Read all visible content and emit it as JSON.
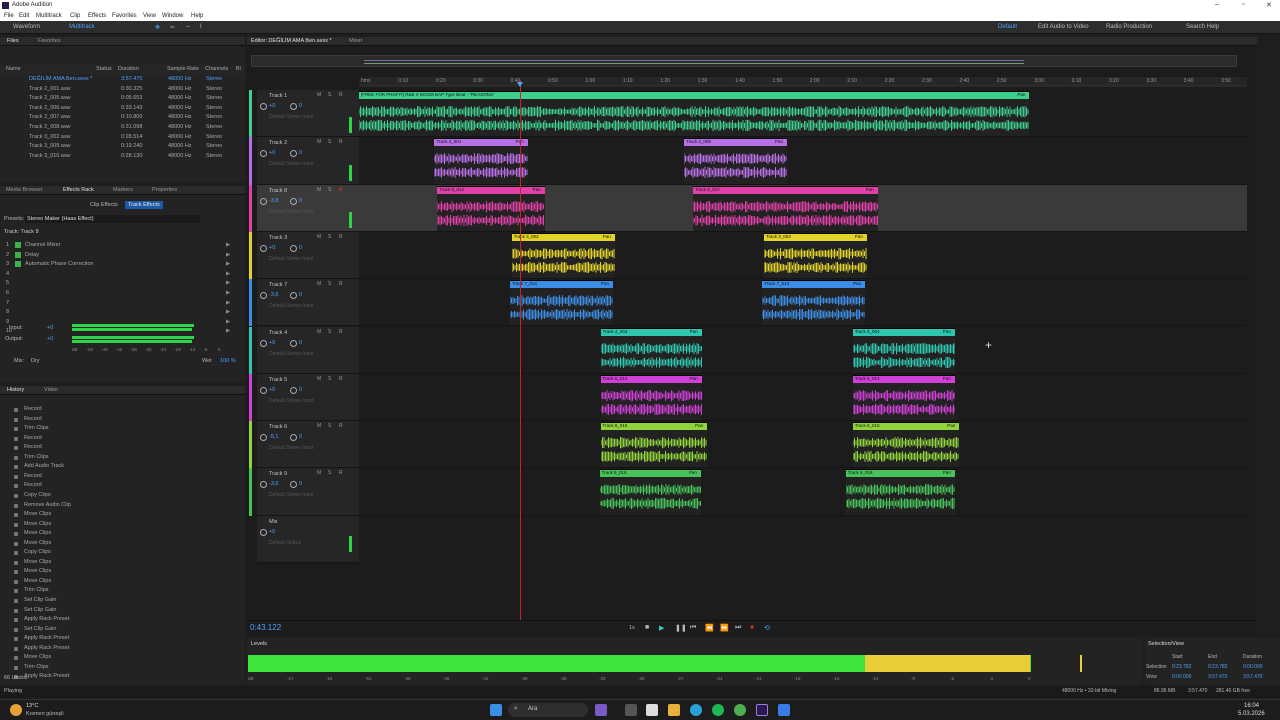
{
  "window": {
    "title": "Adobe Audition"
  },
  "menu": [
    "File",
    "Edit",
    "Multitrack",
    "Clip",
    "Effects",
    "Favorites",
    "View",
    "Window",
    "Help"
  ],
  "toolbar": {
    "waveform": "Waveform",
    "multitrack": "Multitrack",
    "workspaces": [
      "Default",
      "Edit Audio to Video",
      "Radio Production"
    ],
    "search": "Search Help"
  },
  "files_panel": {
    "tabs": [
      "Files",
      "Favorites"
    ],
    "columns": [
      "Name",
      "Status",
      "Duration",
      "Sample Rate",
      "Channels",
      "Bi"
    ],
    "rows": [
      {
        "name": "DEĞİLİM AMA Ben.sesx *",
        "duration": "3:57.470",
        "rate": "48000 Hz",
        "ch": "Stereo"
      },
      {
        "name": "Track 2_001.wav",
        "duration": "0:30.325",
        "rate": "48000 Hz",
        "ch": "Stereo"
      },
      {
        "name": "Track 2_005.wav",
        "duration": "0:05.653",
        "rate": "48000 Hz",
        "ch": "Stereo"
      },
      {
        "name": "Track 2_006.wav",
        "duration": "0:33.143",
        "rate": "48000 Hz",
        "ch": "Stereo"
      },
      {
        "name": "Track 2_007.wav",
        "duration": "0:10.800",
        "rate": "48000 Hz",
        "ch": "Stereo"
      },
      {
        "name": "Track 2_008.wav",
        "duration": "0:31.098",
        "rate": "48000 Hz",
        "ch": "Stereo"
      },
      {
        "name": "Track 3_002.wav",
        "duration": "0:28.514",
        "rate": "48000 Hz",
        "ch": "Stereo"
      },
      {
        "name": "Track 3_009.wav",
        "duration": "0:19.240",
        "rate": "48000 Hz",
        "ch": "Stereo"
      },
      {
        "name": "Track 3_010.wav",
        "duration": "0:28.130",
        "rate": "48000 Hz",
        "ch": "Stereo"
      }
    ]
  },
  "effects_panel": {
    "tabs": [
      "Media Browser",
      "Effects Rack",
      "Markers",
      "Properties"
    ],
    "subtabs": [
      "Clip Effects",
      "Track Effects"
    ],
    "presets_label": "Presets:",
    "preset": "Stereo Maker (Haas Effect)",
    "track_label": "Track: Track 8",
    "effects": [
      {
        "n": "1",
        "name": "Channel Mixer"
      },
      {
        "n": "2",
        "name": "Delay"
      },
      {
        "n": "3",
        "name": "Automatic Phase Correction"
      },
      {
        "n": "4",
        "name": ""
      },
      {
        "n": "5",
        "name": ""
      },
      {
        "n": "6",
        "name": ""
      },
      {
        "n": "7",
        "name": ""
      },
      {
        "n": "8",
        "name": ""
      },
      {
        "n": "9",
        "name": ""
      },
      {
        "n": "10",
        "name": ""
      }
    ],
    "input_label": "Input:",
    "input_val": "+0",
    "output_label": "Output:",
    "output_val": "+0",
    "mix_label": "Mix:",
    "dry": "Dry",
    "wet": "Wet",
    "wet_pct": "100 %",
    "meter_scale": [
      "dB",
      "-54",
      "-48",
      "-42",
      "-36",
      "-30",
      "-24",
      "-18",
      "-12",
      "-6",
      "0"
    ]
  },
  "history_panel": {
    "tabs": [
      "History",
      "Video"
    ],
    "items": [
      "Record",
      "Record",
      "Trim Clips",
      "Record",
      "Record",
      "Trim Clips",
      "Add Audio Track",
      "Record",
      "Record",
      "Copy Clips",
      "Remove Audio Clip",
      "Move Clips",
      "Move Clips",
      "Move Clips",
      "Move Clips",
      "Copy Clips",
      "Move Clips",
      "Move Clips",
      "Move Clips",
      "Trim Clips",
      "Set Clip Gain",
      "Set Clip Gain",
      "Apply Rack Preset",
      "Set Clip Gain",
      "Apply Rack Preset",
      "Apply Rack Preset",
      "Move Clips",
      "Trim Clips",
      "Apply Rack Preset"
    ],
    "undos": "66 Undos"
  },
  "editor": {
    "tab": "Editor: DEĞİLİM AMA Ben.sesx *",
    "mixer_tab": "Mixer",
    "ruler": [
      "hms",
      "0:10",
      "0:20",
      "0:30",
      "0:40",
      "0:50",
      "1:00",
      "1:10",
      "1:20",
      "1:30",
      "1:40",
      "1:50",
      "2:00",
      "2:10",
      "2:20",
      "2:30",
      "2:40",
      "2:50",
      "3:00",
      "3:10",
      "3:20",
      "3:30",
      "3:40",
      "3:50"
    ],
    "time": "0:43.122",
    "transport_speed": "1x",
    "default_input": "Default Stereo Input",
    "default_output": "Default Output"
  },
  "tracks": [
    {
      "name": "Track 1",
      "vol": "+0",
      "pan": "0",
      "color": "#3ecf8e",
      "clips": [
        {
          "name": "[FREE FOR PROFIT] R&B X BOOM BAP Type Beat - \"REASONS\"",
          "pan": "Pan",
          "color": "#3ecf8e",
          "start": 0,
          "end": 0.755
        }
      ]
    },
    {
      "name": "Track 2",
      "vol": "+0",
      "pan": "0",
      "color": "#b86ee6",
      "clips": [
        {
          "name": "Track 2_001",
          "pan": "Pan",
          "color": "#b86ee6",
          "start": 0.085,
          "end": 0.19
        },
        {
          "name": "Track 2_008",
          "pan": "Pan",
          "color": "#b86ee6",
          "start": 0.366,
          "end": 0.482
        }
      ]
    },
    {
      "name": "Track 8",
      "vol": "-3,8",
      "pan": "0",
      "color": "#e040a8",
      "clips": [
        {
          "name": "Track 8_012",
          "pan": "Pan",
          "color": "#e040a8",
          "start": 0.088,
          "end": 0.209
        },
        {
          "name": "Track 8_017",
          "pan": "Pan",
          "color": "#e040a8",
          "start": 0.376,
          "end": 0.584
        }
      ]
    },
    {
      "name": "Track 3",
      "vol": "+0",
      "pan": "0",
      "color": "#e3d22a",
      "clips": [
        {
          "name": "Track 3_002",
          "pan": "Pan",
          "color": "#e3d22a",
          "start": 0.172,
          "end": 0.288
        },
        {
          "name": "Track 3_003",
          "pan": "Pan",
          "color": "#e3d22a",
          "start": 0.456,
          "end": 0.572
        }
      ]
    },
    {
      "name": "Track 7",
      "vol": "-3,6",
      "pan": "0",
      "color": "#3c8de8",
      "clips": [
        {
          "name": "Track 7_013",
          "pan": "Pan",
          "color": "#3c8de8",
          "start": 0.17,
          "end": 0.286
        },
        {
          "name": "Track 7_013",
          "pan": "Pan",
          "color": "#3c8de8",
          "start": 0.454,
          "end": 0.57
        }
      ]
    },
    {
      "name": "Track 4",
      "vol": "+0",
      "pan": "0",
      "color": "#2fc6b0",
      "clips": [
        {
          "name": "Track 4_004",
          "pan": "Pan",
          "color": "#2fc6b0",
          "start": 0.272,
          "end": 0.386
        },
        {
          "name": "Track 4_004",
          "pan": "Pan",
          "color": "#2fc6b0",
          "start": 0.556,
          "end": 0.671
        }
      ]
    },
    {
      "name": "Track 5",
      "vol": "+0",
      "pan": "0",
      "color": "#d040d8",
      "clips": [
        {
          "name": "Track 5_014",
          "pan": "Pan",
          "color": "#d040d8",
          "start": 0.272,
          "end": 0.386
        },
        {
          "name": "Track 5_014",
          "pan": "Pan",
          "color": "#d040d8",
          "start": 0.556,
          "end": 0.671
        }
      ]
    },
    {
      "name": "Track 6",
      "vol": "-5,1",
      "pan": "0",
      "color": "#8fd43a",
      "clips": [
        {
          "name": "Track 6_015",
          "pan": "Pan",
          "color": "#8fd43a",
          "start": 0.272,
          "end": 0.392
        },
        {
          "name": "Track 6_015",
          "pan": "Pan",
          "color": "#8fd43a",
          "start": 0.556,
          "end": 0.676
        }
      ]
    },
    {
      "name": "Track 9",
      "vol": "-3,6",
      "pan": "0",
      "color": "#46c45a",
      "clips": [
        {
          "name": "Track 9_016",
          "pan": "Pan",
          "color": "#46c45a",
          "start": 0.271,
          "end": 0.385
        },
        {
          "name": "Track 9_016",
          "pan": "Pan",
          "color": "#46c45a",
          "start": 0.548,
          "end": 0.671
        }
      ]
    }
  ],
  "mix_track": {
    "name": "Mix",
    "vol": "+0"
  },
  "levels": {
    "title": "Levels",
    "scale": [
      "dB",
      "-57",
      "-54",
      "-51",
      "-48",
      "-45",
      "-42",
      "-39",
      "-36",
      "-33",
      "-30",
      "-27",
      "-24",
      "-21",
      "-18",
      "-15",
      "-12",
      "-9",
      "-6",
      "-3",
      "0"
    ]
  },
  "selection_view": {
    "title": "Selection/View",
    "headers": [
      "Start",
      "End",
      "Duration"
    ],
    "selection": {
      "label": "Selection",
      "start": "0:23.782",
      "end": "0:23.782",
      "dur": "0:00.000"
    },
    "view": {
      "label": "View",
      "start": "0:00.000",
      "end": "3:57.470",
      "dur": "3:57.470"
    }
  },
  "status": {
    "left": "Playing",
    "info": "48000 Hz • 32-bit Mixing",
    "size": "86.96 MB",
    "dur": "3:57.470",
    "free": "281.46 GB free"
  },
  "taskbar": {
    "temp": "13°C",
    "weather": "Kısmen güneşli",
    "search": "Ara",
    "time": "16:04",
    "date": "5.03.2026"
  }
}
